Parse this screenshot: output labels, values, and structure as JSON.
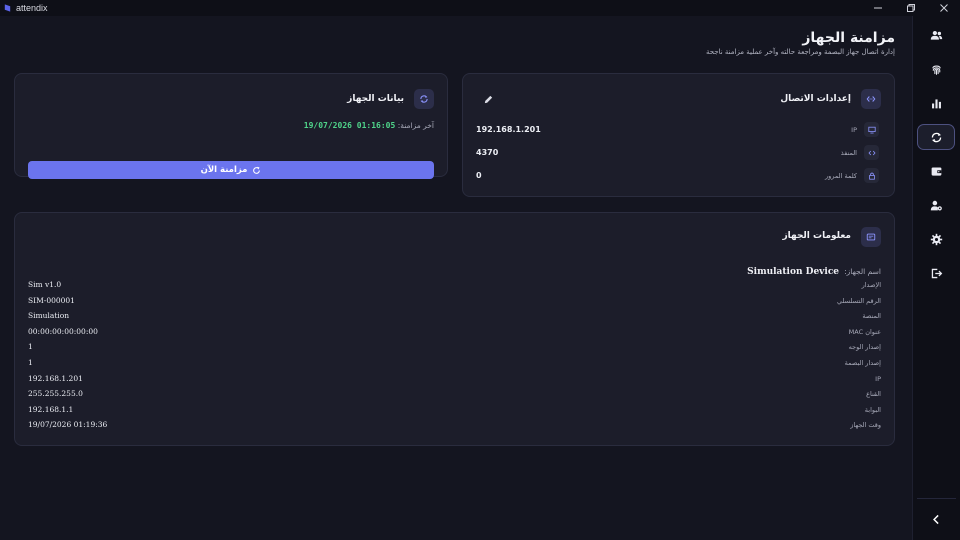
{
  "window": {
    "title": "attendix"
  },
  "colors": {
    "accent": "#6b74ee",
    "success": "#4fd48a",
    "background": "#141520",
    "card": "#1c1d2a"
  },
  "sidebar": {
    "items": [
      {
        "icon": "users-icon",
        "active": false
      },
      {
        "icon": "fingerprint-icon",
        "active": false
      },
      {
        "icon": "bar-chart-icon",
        "active": false
      },
      {
        "icon": "sync-icon",
        "active": true
      },
      {
        "icon": "wallet-icon",
        "active": false
      },
      {
        "icon": "user-settings-icon",
        "active": false
      },
      {
        "icon": "gear-icon",
        "active": false
      },
      {
        "icon": "logout-icon",
        "active": false
      }
    ],
    "collapse_icon": "chevron-left-icon"
  },
  "header": {
    "title": "مزامنة الجهاز",
    "subtitle": "إدارة اتصال جهاز البصمة ومراجعة حالته وآخر عملية مزامنة ناجحة"
  },
  "connection": {
    "title": "إعدادات الاتصال",
    "rows": [
      {
        "label": "IP",
        "value": "192.168.1.201",
        "icon": "monitor-icon"
      },
      {
        "label": "المنفذ",
        "value": "4370",
        "icon": "code-icon"
      },
      {
        "label": "كلمة المرور",
        "value": "0",
        "icon": "lock-icon"
      }
    ]
  },
  "device_data": {
    "title": "بيانات الجهاز",
    "last_sync_label": "آخر مزامنة:",
    "last_sync_value": "19/07/2026 01:16:05",
    "sync_button": "مزامنة الآن"
  },
  "device_info": {
    "title": "معلومات الجهاز",
    "name_label": "اسم الجهاز:",
    "name_value": "Simulation Device",
    "rows": [
      {
        "label": "الإصدار",
        "value": "Sim v1.0"
      },
      {
        "label": "الرقم التسلسلي",
        "value": "SIM-000001"
      },
      {
        "label": "المنصة",
        "value": "Simulation"
      },
      {
        "label": "عنوان MAC",
        "value": "00:00:00:00:00:00"
      },
      {
        "label": "إصدار الوجه",
        "value": "1"
      },
      {
        "label": "إصدار البصمة",
        "value": "1"
      },
      {
        "label": "IP",
        "value": "192.168.1.201"
      },
      {
        "label": "القناع",
        "value": "255.255.255.0"
      },
      {
        "label": "البوابة",
        "value": "192.168.1.1"
      },
      {
        "label": "وقت الجهاز",
        "value": "19/07/2026 01:19:36"
      }
    ]
  }
}
